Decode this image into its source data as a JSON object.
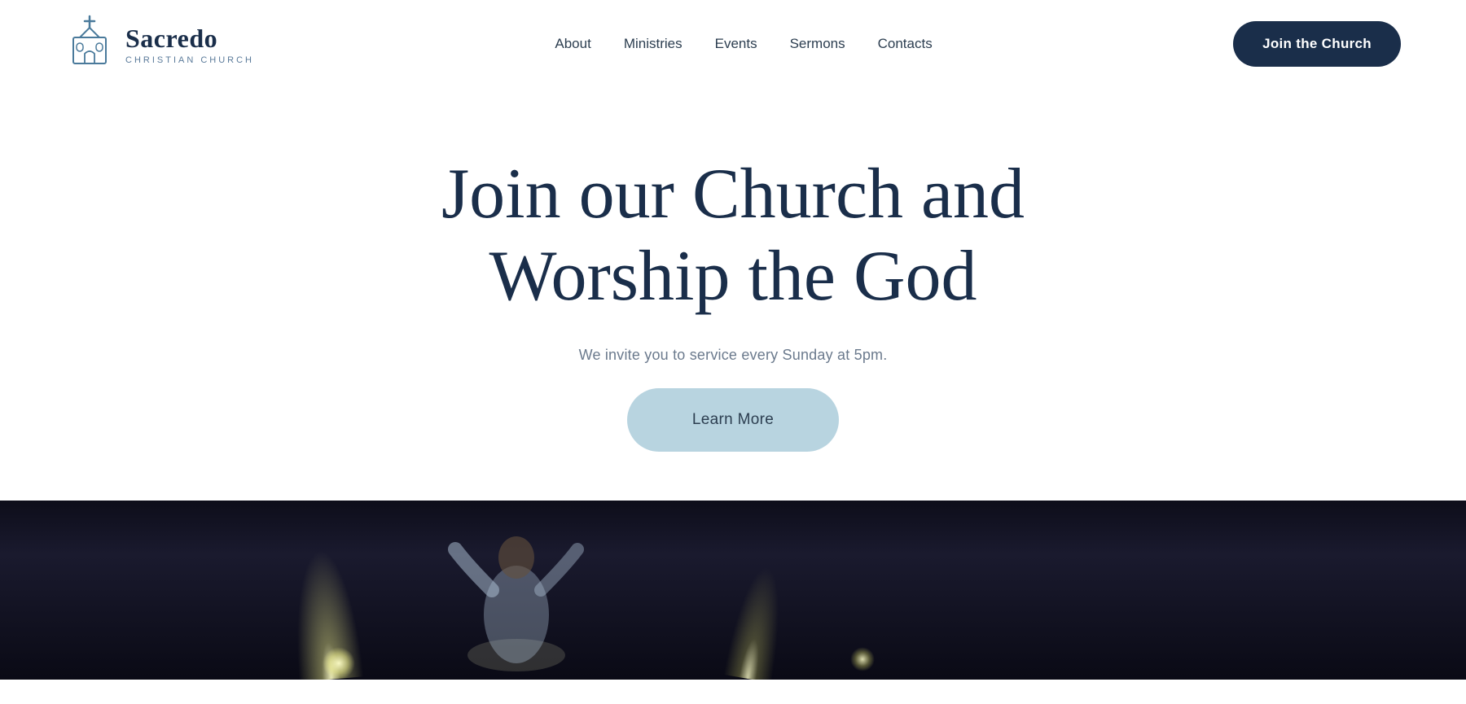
{
  "brand": {
    "name": "Sacredo",
    "subtitle": "CHRISTIAN CHURCH"
  },
  "nav": {
    "items": [
      {
        "label": "About",
        "id": "about"
      },
      {
        "label": "Ministries",
        "id": "ministries"
      },
      {
        "label": "Events",
        "id": "events"
      },
      {
        "label": "Sermons",
        "id": "sermons"
      },
      {
        "label": "Contacts",
        "id": "contacts"
      }
    ],
    "cta_label": "Join the Church"
  },
  "hero": {
    "title_line1": "Join our Church and",
    "title_line2": "Worship the God",
    "subtitle": "We invite you to service every Sunday at 5pm.",
    "cta_label": "Learn More"
  },
  "colors": {
    "navy": "#1a2e4a",
    "light_blue_btn": "#b8d4e0",
    "text_gray": "#6b7a8d"
  }
}
